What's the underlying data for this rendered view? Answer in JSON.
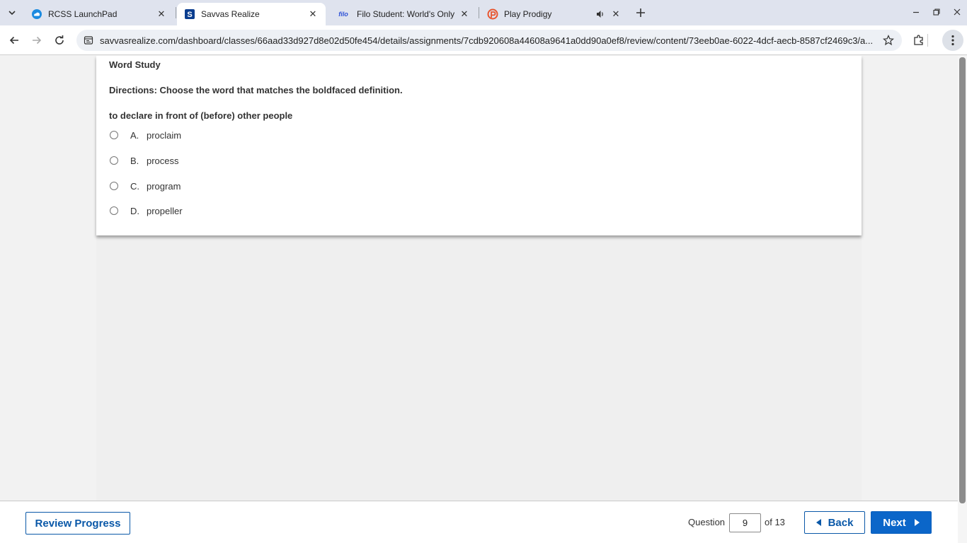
{
  "browser": {
    "tabs": [
      {
        "title": "RCSS LaunchPad",
        "favicon": "cloud-icon",
        "active": false
      },
      {
        "title": "Savvas Realize",
        "favicon": "savvas-icon",
        "active": true
      },
      {
        "title": "Filo Student: World's Only Live",
        "favicon": "filo-icon",
        "favicon_text": "filo",
        "active": false
      },
      {
        "title": "Play Prodigy",
        "favicon": "prodigy-icon",
        "active": false
      }
    ],
    "url": "savvasrealize.com/dashboard/classes/66aad33d927d8e02d50fe454/details/assignments/7cdb920608a44608a9641a0dd90a0ef8/review/content/73eeb0ae-6022-4dcf-aecb-8587cf2469c3/a...",
    "colors": {
      "tabstrip": "#dfe3ee",
      "omnibox": "#edf0f5"
    }
  },
  "question": {
    "section_title": "Word Study",
    "directions": "Directions: Choose the word that matches the boldfaced definition.",
    "prompt": "to declare in front of (before) other people",
    "options": [
      {
        "letter": "A.",
        "text": "proclaim"
      },
      {
        "letter": "B.",
        "text": "process"
      },
      {
        "letter": "C.",
        "text": "program"
      },
      {
        "letter": "D.",
        "text": "propeller"
      }
    ]
  },
  "footer": {
    "review_progress_label": "Review Progress",
    "question_label": "Question",
    "current_question": "9",
    "of_label": "of 13",
    "back_label": "Back",
    "next_label": "Next",
    "accent_color": "#0b66c9"
  }
}
